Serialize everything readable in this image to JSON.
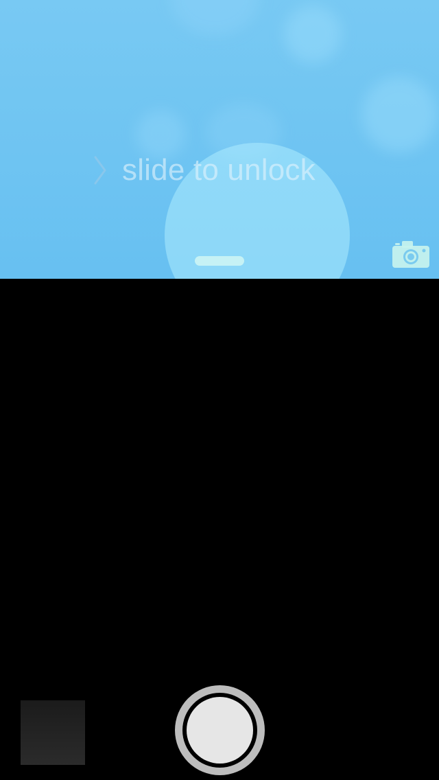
{
  "lockscreen": {
    "slide_text": "slide to unlock",
    "background_color": "#6bc2f2",
    "text_color": "rgba(225,242,252,0.62)"
  },
  "icons": {
    "chevron": "chevron-right-icon",
    "camera": "camera-icon"
  },
  "camera": {
    "background_color": "#000000",
    "shutter_outer_color": "#bdbdbd",
    "shutter_inner_color": "#e6e6e6"
  }
}
